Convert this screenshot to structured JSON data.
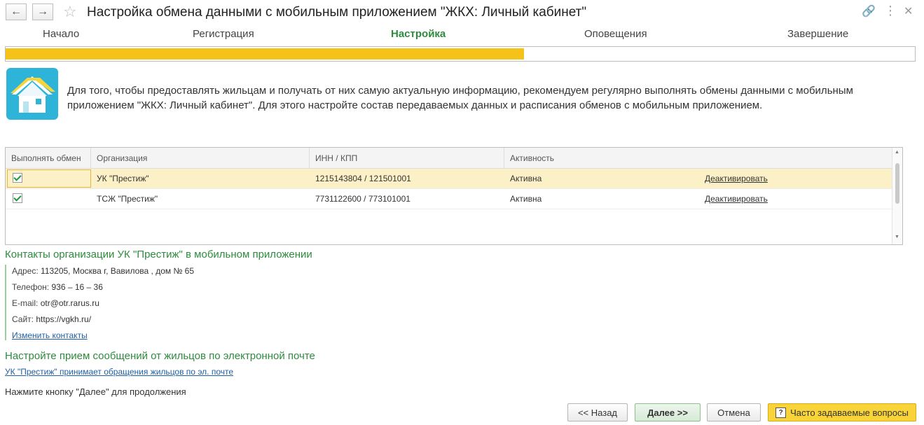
{
  "window": {
    "title": "Настройка обмена данными с мобильным приложением \"ЖКХ: Личный кабинет\"",
    "back_icon": "back-arrow-icon",
    "forward_icon": "forward-arrow-icon",
    "favorite_icon": "star-icon",
    "link_icon": "link-icon",
    "more_icon": "more-icon",
    "close_icon": "close-icon"
  },
  "steps": [
    {
      "label": "Начало"
    },
    {
      "label": "Регистрация"
    },
    {
      "label": "Настройка"
    },
    {
      "label": "Оповещения"
    },
    {
      "label": "Завершение"
    }
  ],
  "active_step": "Настройка",
  "progress": {
    "fraction": 0.57,
    "color": "#f5c21a"
  },
  "intro": {
    "icon": "house-icon",
    "text": "Для того, чтобы предоставлять жильцам и получать от них самую актуальную информацию, рекомендуем регулярно выполнять обмены данными с мобильным приложением \"ЖКХ: Личный кабинет\". Для этого настройте состав передаваемых данных и расписания обменов с мобильным приложением."
  },
  "table": {
    "columns": [
      "Выполнять обмен",
      "Организация",
      "ИНН / КПП",
      "Активность"
    ],
    "rows": [
      {
        "checked": true,
        "org": "УК \"Престиж\"",
        "inn": "1215143804 / 121501001",
        "status": "Активна",
        "action": "Деактивировать"
      },
      {
        "checked": true,
        "org": "ТСЖ \"Престиж\"",
        "inn": "7731122600 / 773101001",
        "status": "Активна",
        "action": "Деактивировать"
      }
    ]
  },
  "contacts": {
    "title": "Контакты организации УК \"Престиж\" в мобильном приложении",
    "address_label": "Адрес:",
    "address": "113205, Москва г, Вавилова , дом № 65",
    "phone_label": "Телефон:",
    "phone": "936 – 16 – 36",
    "email_label": "E-mail:",
    "email": "otr@otr.rarus.ru",
    "site_label": "Сайт:",
    "site": "https://vgkh.ru/",
    "edit_link": "Изменить контакты"
  },
  "email_setup": {
    "title": "Настройте прием сообщений от жильцов по электронной почте",
    "link": "УК \"Престиж\" принимает обращения жильцов по эл. почте"
  },
  "hint": "Нажмите кнопку \"Далее\" для продолжения",
  "buttons": {
    "back": "<< Назад",
    "next": "Далее >>",
    "cancel": "Отмена",
    "faq": "Часто задаваемые вопросы"
  }
}
